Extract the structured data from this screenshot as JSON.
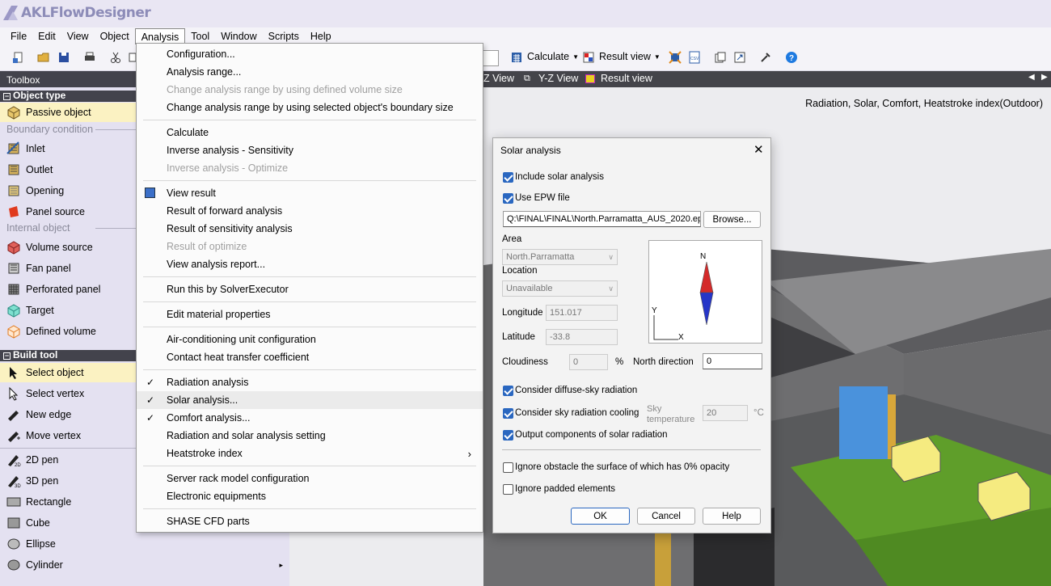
{
  "app": {
    "title": "AKLFlowDesigner"
  },
  "menubar": [
    "File",
    "Edit",
    "View",
    "Object",
    "Analysis",
    "Tool",
    "Window",
    "Scripts",
    "Help"
  ],
  "toolbar": {
    "calculate": "Calculate",
    "result_view": "Result view"
  },
  "toolbox": {
    "title": "Toolbox",
    "object_type": "Object type",
    "passive": "Passive object",
    "boundary": "Boundary condition",
    "boundary_items": [
      "Inlet",
      "Outlet",
      "Opening",
      "Panel source"
    ],
    "internal": "Internal object",
    "internal_items": [
      "Volume source",
      "Fan panel",
      "Perforated panel",
      "Target",
      "Defined volume"
    ],
    "build_tool": "Build tool",
    "build_items": [
      "Select object",
      "Select vertex",
      "New edge",
      "Move vertex"
    ],
    "shape_items": [
      "2D pen",
      "3D pen",
      "Rectangle",
      "Cube",
      "Ellipse",
      "Cylinder"
    ]
  },
  "view_tabs": [
    "Z View",
    "Y-Z View",
    "Result view"
  ],
  "viewport": {
    "caption": "Radiation, Solar, Comfort, Heatstroke index(Outdoor)"
  },
  "analysis_menu": {
    "g1": [
      "Configuration...",
      "Analysis range...",
      "Change analysis range by using defined volume size",
      "Change analysis range by using selected object's boundary size"
    ],
    "g2": [
      "Calculate",
      "Inverse analysis - Sensitivity",
      "Inverse analysis - Optimize"
    ],
    "g3": [
      "View result",
      "Result of forward analysis",
      "Result of sensitivity analysis",
      "Result of optimize",
      "View analysis report..."
    ],
    "g4": [
      "Run this by SolverExecutor"
    ],
    "g5": [
      "Edit material properties"
    ],
    "g6": [
      "Air-conditioning unit configuration",
      "Contact heat transfer coefficient"
    ],
    "g7": [
      "Radiation analysis",
      "Solar analysis...",
      "Comfort analysis...",
      "Radiation and solar analysis setting",
      "Heatstroke index"
    ],
    "g8": [
      "Server rack model configuration",
      "Electronic equipments"
    ],
    "g9": [
      "SHASE CFD parts"
    ]
  },
  "dialog": {
    "title": "Solar analysis",
    "include_solar": "Include solar analysis",
    "use_epw": "Use EPW file",
    "epw_path": "Q:\\FINAL\\FINAL\\North.Parramatta_AUS_2020.ep",
    "browse": "Browse...",
    "area_label": "Area",
    "area_value": "North.Parramatta",
    "location_label": "Location",
    "location_value": "Unavailable",
    "longitude_label": "Longitude",
    "longitude_value": "151.017",
    "latitude_label": "Latitude",
    "latitude_value": "-33.8",
    "cloudiness_label": "Cloudiness",
    "cloudiness_value": "0",
    "percent": "%",
    "north_label": "North direction",
    "north_value": "0",
    "compass_n": "N",
    "axis_y": "Y",
    "axis_x": "X",
    "diffuse": "Consider diffuse-sky radiation",
    "sky_cooling": "Consider sky radiation cooling",
    "sky_temp_label": "Sky temperature",
    "sky_temp_value": "20",
    "celsius": "°C",
    "output_components": "Output components of solar radiation",
    "ignore_obstacle": "Ignore obstacle the surface of which has 0% opacity",
    "ignore_padded": "Ignore padded elements",
    "ok": "OK",
    "cancel": "Cancel",
    "help": "Help"
  },
  "colors": {
    "accent": "#2a67c0",
    "toolbox_bg": "#e4e1f1",
    "header_dark": "#43434c",
    "selected": "#fbf2c2"
  }
}
